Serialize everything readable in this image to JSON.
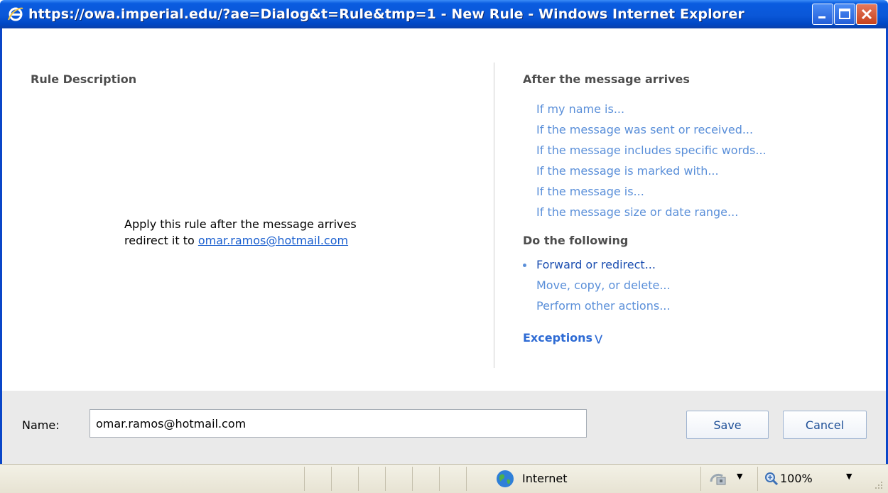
{
  "window": {
    "title": "https://owa.imperial.edu/?ae=Dialog&t=Rule&tmp=1 - New Rule - Windows Internet Explorer"
  },
  "left": {
    "heading": "Rule Description",
    "line1": "Apply this rule after the message arrives",
    "line2_prefix": "redirect it to ",
    "email_link": "omar.ramos@hotmail.com"
  },
  "right": {
    "conditions_heading": "After the message arrives",
    "conditions": [
      "If my name is...",
      "If the message was sent or received...",
      "If the message includes specific words...",
      "If the message is marked with...",
      "If the message is...",
      "If the message size or date range..."
    ],
    "actions_heading": "Do the following",
    "actions": [
      "Forward or redirect...",
      "Move, copy, or delete...",
      "Perform other actions..."
    ],
    "exceptions_label": "Exceptions",
    "exceptions_chevron": "»"
  },
  "form": {
    "name_label": "Name:",
    "name_value": "omar.ramos@hotmail.com",
    "save_label": "Save",
    "cancel_label": "Cancel"
  },
  "status": {
    "zone_label": "Internet",
    "zoom_label": "100%"
  },
  "icons": {
    "browser": "ie-icon",
    "minimize": "minimize-icon",
    "maximize": "maximize-icon",
    "close": "close-icon",
    "zone": "globe-icon",
    "protected_mode": "protected-mode-icon",
    "zoom": "zoom-icon"
  },
  "colors": {
    "title_bar": "#0a57d8",
    "link": "#5a8fd9",
    "active_link": "#1c4fb1",
    "close_button": "#c8421c"
  }
}
